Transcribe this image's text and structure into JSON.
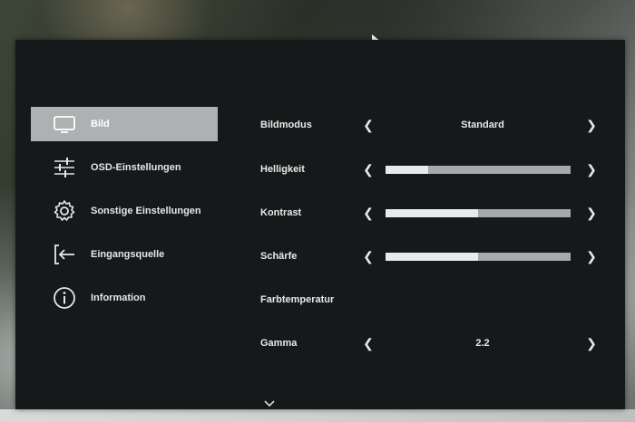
{
  "sidebar": {
    "items": [
      {
        "label": "Bild",
        "icon": "monitor-icon",
        "active": true
      },
      {
        "label": "OSD-Einstellungen",
        "icon": "sliders-icon",
        "active": false
      },
      {
        "label": "Sonstige Einstellungen",
        "icon": "gear-icon",
        "active": false
      },
      {
        "label": "Eingangsquelle",
        "icon": "input-source-icon",
        "active": false
      },
      {
        "label": "Information",
        "icon": "info-icon",
        "active": false
      }
    ]
  },
  "settings": {
    "bildmodus": {
      "label": "Bildmodus",
      "value": "Standard"
    },
    "helligkeit": {
      "label": "Helligkeit",
      "level": 0.23
    },
    "kontrast": {
      "label": "Kontrast",
      "level": 0.5
    },
    "schaerfe": {
      "label": "Schärfe",
      "level": 0.5
    },
    "farbtemperatur": {
      "label": "Farbtemperatur"
    },
    "gamma": {
      "label": "Gamma",
      "value": "2.2"
    }
  },
  "colors": {
    "osd_background": "#15191a",
    "active_item": "#aeb0b2",
    "slider_track": "#a6a9ab",
    "slider_fill": "#e8eaeb"
  }
}
